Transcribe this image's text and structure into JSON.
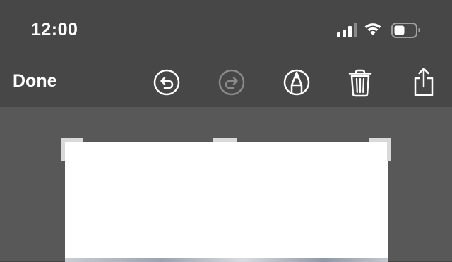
{
  "status_bar": {
    "time": "12:00",
    "icons": [
      "cellular-signal-icon",
      "wifi-icon",
      "battery-icon"
    ]
  },
  "toolbar": {
    "done_label": "Done",
    "tools": [
      "undo-icon",
      "redo-icon",
      "markup-pen-icon",
      "trash-icon",
      "share-icon"
    ],
    "redo_enabled": false
  },
  "colors": {
    "bar_background": "#474747",
    "canvas_background": "#585858",
    "icon_active": "#ffffff",
    "icon_disabled": "#8a8a8a"
  }
}
